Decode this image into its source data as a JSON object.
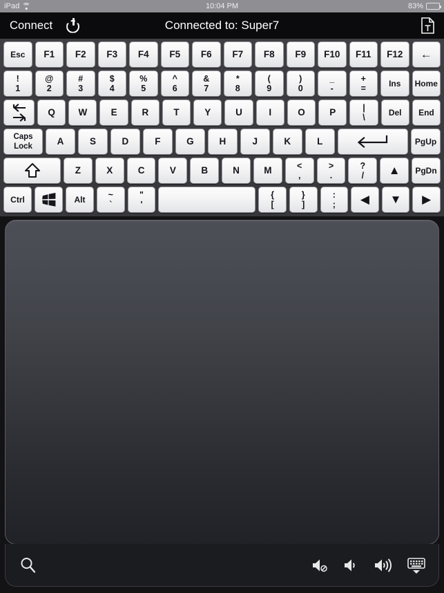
{
  "statusbar": {
    "device": "iPad",
    "wifi_icon": "wifi-icon",
    "time": "10:04 PM",
    "battery_percent": "83%",
    "battery_level": 83
  },
  "navbar": {
    "connect_label": "Connect",
    "power_icon": "power-icon",
    "title": "Connected to: Super7",
    "document_icon": "text-document-icon"
  },
  "keyboard": {
    "rows": [
      {
        "name": "function-row",
        "keys": [
          {
            "name": "esc",
            "label": "Esc",
            "style": "sm"
          },
          {
            "name": "f1",
            "label": "F1"
          },
          {
            "name": "f2",
            "label": "F2"
          },
          {
            "name": "f3",
            "label": "F3"
          },
          {
            "name": "f4",
            "label": "F4"
          },
          {
            "name": "f5",
            "label": "F5"
          },
          {
            "name": "f6",
            "label": "F6"
          },
          {
            "name": "f7",
            "label": "F7"
          },
          {
            "name": "f8",
            "label": "F8"
          },
          {
            "name": "f9",
            "label": "F9"
          },
          {
            "name": "f10",
            "label": "F10"
          },
          {
            "name": "f11",
            "label": "F11"
          },
          {
            "name": "f12",
            "label": "F12"
          },
          {
            "name": "backspace",
            "label": "←",
            "style": "glyph"
          }
        ]
      },
      {
        "name": "number-row",
        "keys": [
          {
            "name": "1",
            "top": "!",
            "bot": "1"
          },
          {
            "name": "2",
            "top": "@",
            "bot": "2"
          },
          {
            "name": "3",
            "top": "#",
            "bot": "3"
          },
          {
            "name": "4",
            "top": "$",
            "bot": "4"
          },
          {
            "name": "5",
            "top": "%",
            "bot": "5"
          },
          {
            "name": "6",
            "top": "^",
            "bot": "6"
          },
          {
            "name": "7",
            "top": "&",
            "bot": "7"
          },
          {
            "name": "8",
            "top": "*",
            "bot": "8"
          },
          {
            "name": "9",
            "top": "(",
            "bot": "9"
          },
          {
            "name": "0",
            "top": ")",
            "bot": "0"
          },
          {
            "name": "minus",
            "top": "_",
            "bot": "-"
          },
          {
            "name": "equals",
            "top": "+",
            "bot": "="
          },
          {
            "name": "insert",
            "label": "Ins",
            "style": "sm"
          },
          {
            "name": "home",
            "label": "Home",
            "style": "sm"
          }
        ]
      },
      {
        "name": "qwerty-row",
        "keys": [
          {
            "name": "tab",
            "icon": "tab-arrows-icon"
          },
          {
            "name": "q",
            "label": "Q"
          },
          {
            "name": "w",
            "label": "W"
          },
          {
            "name": "e",
            "label": "E"
          },
          {
            "name": "r",
            "label": "R"
          },
          {
            "name": "t",
            "label": "T"
          },
          {
            "name": "y",
            "label": "Y"
          },
          {
            "name": "u",
            "label": "U"
          },
          {
            "name": "i",
            "label": "I"
          },
          {
            "name": "o",
            "label": "O"
          },
          {
            "name": "p",
            "label": "P"
          },
          {
            "name": "backslash",
            "top": "|",
            "bot": "\\"
          },
          {
            "name": "delete",
            "label": "Del",
            "style": "sm"
          },
          {
            "name": "end",
            "label": "End",
            "style": "sm"
          }
        ]
      },
      {
        "name": "home-row",
        "keys": [
          {
            "name": "caps-lock",
            "lines": [
              "Caps",
              "Lock"
            ]
          },
          {
            "name": "a",
            "label": "A"
          },
          {
            "name": "s",
            "label": "S"
          },
          {
            "name": "d",
            "label": "D"
          },
          {
            "name": "f",
            "label": "F"
          },
          {
            "name": "g",
            "label": "G"
          },
          {
            "name": "h",
            "label": "H"
          },
          {
            "name": "j",
            "label": "J"
          },
          {
            "name": "k",
            "label": "K"
          },
          {
            "name": "l",
            "label": "L"
          },
          {
            "name": "enter",
            "icon": "enter-arrow-icon"
          },
          {
            "name": "page-up",
            "label": "PgUp",
            "style": "sm"
          }
        ]
      },
      {
        "name": "shift-row",
        "keys": [
          {
            "name": "shift",
            "icon": "shift-up-arrow-icon"
          },
          {
            "name": "z",
            "label": "Z"
          },
          {
            "name": "x",
            "label": "X"
          },
          {
            "name": "c",
            "label": "C"
          },
          {
            "name": "v",
            "label": "V"
          },
          {
            "name": "b",
            "label": "B"
          },
          {
            "name": "n",
            "label": "N"
          },
          {
            "name": "m",
            "label": "M"
          },
          {
            "name": "comma",
            "top": "<",
            "bot": ","
          },
          {
            "name": "period",
            "top": ">",
            "bot": "."
          },
          {
            "name": "slash",
            "top": "?",
            "bot": "/"
          },
          {
            "name": "arrow-up",
            "label": "▲",
            "style": "glyph"
          },
          {
            "name": "page-down",
            "label": "PgDn",
            "style": "sm"
          }
        ]
      },
      {
        "name": "modifier-row",
        "keys": [
          {
            "name": "ctrl",
            "label": "Ctrl",
            "style": "sm"
          },
          {
            "name": "windows",
            "icon": "windows-logo-icon"
          },
          {
            "name": "alt",
            "label": "Alt",
            "style": "sm"
          },
          {
            "name": "grave",
            "top": "~",
            "bot": "`"
          },
          {
            "name": "quote",
            "top": "\"",
            "bot": "'"
          },
          {
            "name": "space",
            "label": ""
          },
          {
            "name": "bracket-left",
            "top": "{",
            "bot": "["
          },
          {
            "name": "bracket-right",
            "top": "}",
            "bot": "]"
          },
          {
            "name": "semicolon",
            "top": ":",
            "bot": ";"
          },
          {
            "name": "arrow-left",
            "label": "◀",
            "style": "glyph"
          },
          {
            "name": "arrow-down",
            "label": "▼",
            "style": "glyph"
          },
          {
            "name": "arrow-right",
            "label": "▶",
            "style": "glyph"
          }
        ]
      }
    ]
  },
  "trackpad": {
    "name": "trackpad-surface"
  },
  "bottombar": {
    "search_icon": "search-icon",
    "mute_icon": "volume-mute-icon",
    "volume_down_icon": "volume-down-icon",
    "volume_up_icon": "volume-up-icon",
    "hide_keyboard_icon": "hide-keyboard-icon"
  },
  "colors": {
    "nav_background": "#0b0b0d",
    "status_background": "#8e8e93",
    "keyboard_background": "#3a3a3e",
    "key_face": "#f4f4f5",
    "key_text": "#14141a",
    "trackpad_top": "#4d4f57",
    "trackpad_bottom": "#212227",
    "bottombar_background": "#1b1c20",
    "icon_color": "#e8e8e8"
  }
}
